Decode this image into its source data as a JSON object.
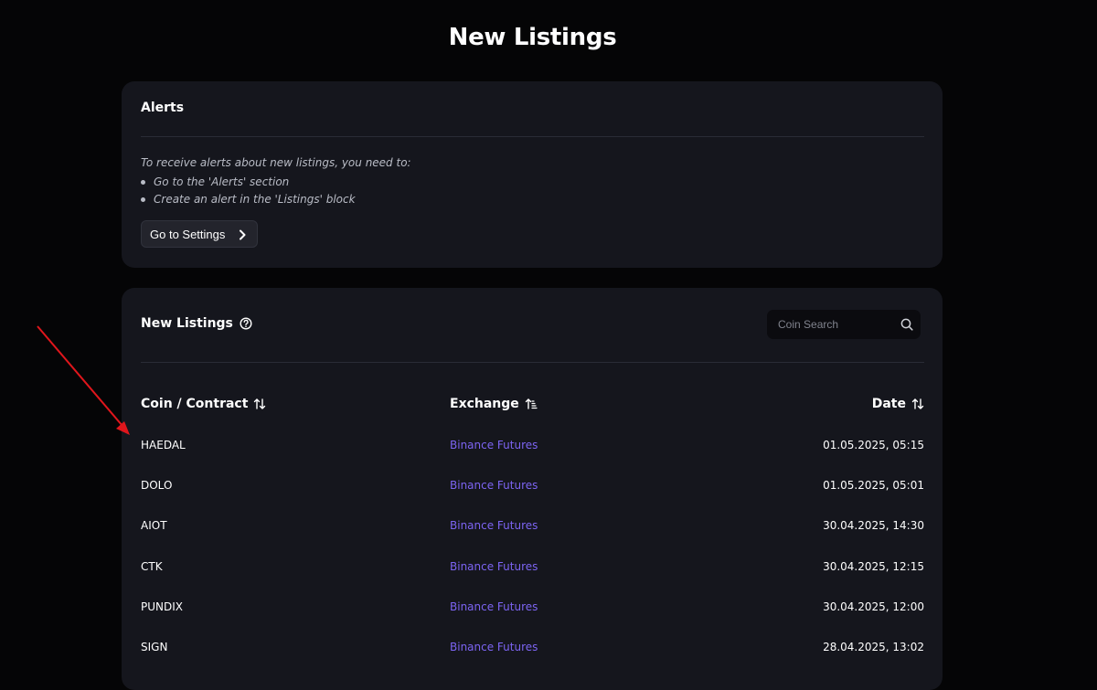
{
  "page": {
    "title": "New Listings"
  },
  "alerts": {
    "title": "Alerts",
    "intro": "To receive alerts about new listings, you need to:",
    "steps": [
      "Go to the 'Alerts' section",
      "Create an alert in the 'Listings' block"
    ],
    "button_label": "Go to Settings"
  },
  "listings": {
    "title": "New Listings",
    "search_placeholder": "Coin Search",
    "columns": {
      "coin": "Coin / Contract",
      "exchange": "Exchange",
      "date": "Date"
    },
    "rows": [
      {
        "coin": "HAEDAL",
        "exchange": "Binance Futures",
        "date": "01.05.2025, 05:15"
      },
      {
        "coin": "DOLO",
        "exchange": "Binance Futures",
        "date": "01.05.2025, 05:01"
      },
      {
        "coin": "AIOT",
        "exchange": "Binance Futures",
        "date": "30.04.2025, 14:30"
      },
      {
        "coin": "CTK",
        "exchange": "Binance Futures",
        "date": "30.04.2025, 12:15"
      },
      {
        "coin": "PUNDIX",
        "exchange": "Binance Futures",
        "date": "30.04.2025, 12:00"
      },
      {
        "coin": "SIGN",
        "exchange": "Binance Futures",
        "date": "28.04.2025, 13:02"
      }
    ]
  },
  "colors": {
    "background": "#050506",
    "card": "#15161d",
    "link": "#7c64f2",
    "annotation_arrow": "#e0161c"
  }
}
